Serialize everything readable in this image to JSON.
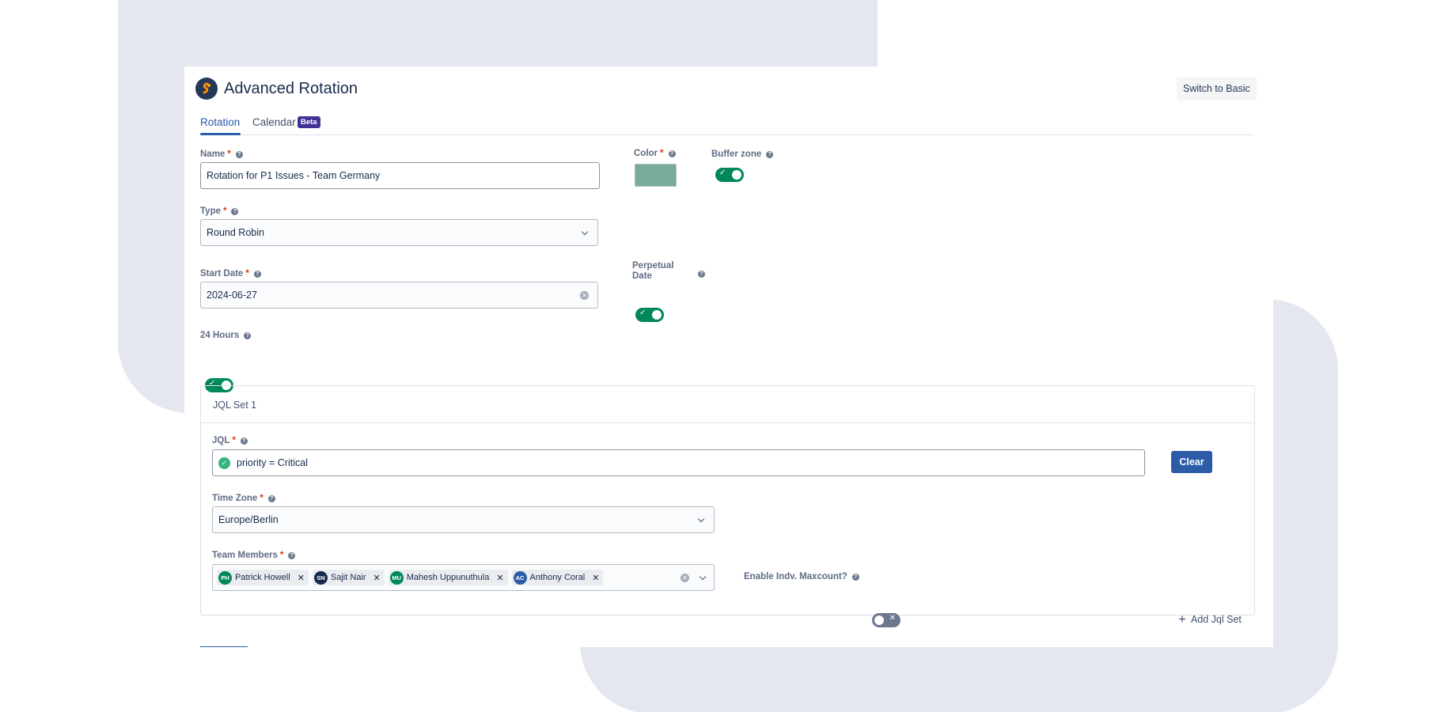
{
  "app": {
    "title": "Advanced Rotation",
    "switch_label": "Switch to Basic"
  },
  "tabs": [
    {
      "label": "Rotation",
      "active": true
    },
    {
      "label": "Calendar",
      "badge": "Beta",
      "active": false
    }
  ],
  "form": {
    "name": {
      "label": "Name",
      "value": "Rotation for P1 Issues - Team Germany"
    },
    "color": {
      "label": "Color",
      "value": "#79ab9a"
    },
    "buffer_zone": {
      "label": "Buffer zone",
      "enabled": true
    },
    "type": {
      "label": "Type",
      "value": "Round Robin"
    },
    "start_date": {
      "label": "Start Date",
      "value": "2024-06-27"
    },
    "perpetual_date": {
      "label_line1": "Perpetual",
      "label_line2": "Date",
      "enabled": true
    },
    "hours24": {
      "label": "24 Hours",
      "enabled": true
    }
  },
  "jql_set": {
    "title": "JQL Set 1",
    "jql": {
      "label": "JQL",
      "value": "priority = Critical"
    },
    "clear_label": "Clear",
    "time_zone": {
      "label": "Time Zone",
      "value": "Europe/Berlin"
    },
    "team_members": {
      "label": "Team Members",
      "members": [
        {
          "initials": "PH",
          "name": "Patrick Howell",
          "color": "#00875a"
        },
        {
          "initials": "SN",
          "name": "Sajit Nair",
          "color": "#172b4d"
        },
        {
          "initials": "MU",
          "name": "Mahesh Uppunuthula",
          "color": "#00875a"
        },
        {
          "initials": "AC",
          "name": "Anthony Coral",
          "color": "#2c5ba8"
        }
      ]
    },
    "maxcount": {
      "label": "Enable Indv. Maxcount?",
      "enabled": false
    }
  },
  "add_jql_label": "Add Jql Set",
  "help_glyph": "?",
  "required_glyph": "*",
  "check_glyph": "✓",
  "cross_glyph": "✕"
}
